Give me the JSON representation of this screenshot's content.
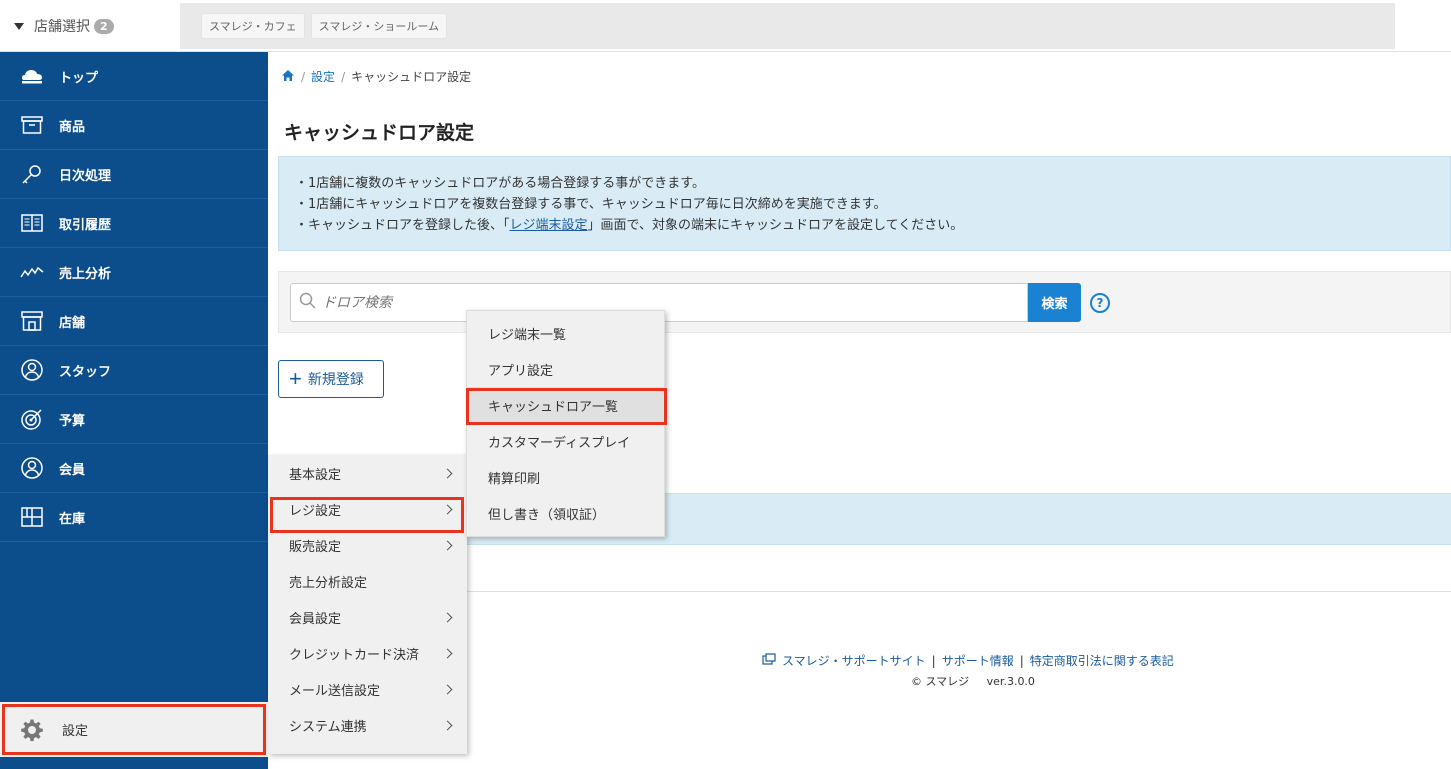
{
  "topbar": {
    "store_select_label": "店舗選択",
    "store_count": "2",
    "store_tabs": [
      "スマレジ・カフェ",
      "スマレジ・ショールーム"
    ]
  },
  "sidebar": {
    "items": [
      {
        "label": "トップ",
        "icon": "cloud-icon"
      },
      {
        "label": "商品",
        "icon": "box-icon"
      },
      {
        "label": "日次処理",
        "icon": "key-icon"
      },
      {
        "label": "取引履歴",
        "icon": "book-icon"
      },
      {
        "label": "売上分析",
        "icon": "chart-line-icon"
      },
      {
        "label": "店舗",
        "icon": "store-icon"
      },
      {
        "label": "スタッフ",
        "icon": "person-icon"
      },
      {
        "label": "予算",
        "icon": "target-icon"
      },
      {
        "label": "会員",
        "icon": "member-icon"
      },
      {
        "label": "在庫",
        "icon": "grid-icon"
      }
    ],
    "settings_label": "設定"
  },
  "breadcrumb": {
    "level1": "設定",
    "current": "キャッシュドロア設定"
  },
  "page": {
    "title": "キャッシュドロア設定",
    "info_line1": "・1店舗に複数のキャッシュドロアがある場合登録する事ができます。",
    "info_line2": "・1店舗にキャッシュドロアを複数台登録する事で、キャッシュドロア毎に日次締めを実施できます。",
    "info_line3_prefix": "・キャッシュドロアを登録した後、「",
    "info_line3_link": "レジ端末設定",
    "info_line3_suffix": "」画面で、対象の端末にキャッシュドロアを設定してください。",
    "search_placeholder": "ドロア検索",
    "search_button": "検索",
    "help": "?",
    "new_button": "新規登録"
  },
  "menu_level1": {
    "items": [
      {
        "label": "基本設定",
        "has_sub": true
      },
      {
        "label": "レジ設定",
        "has_sub": true
      },
      {
        "label": "販売設定",
        "has_sub": true
      },
      {
        "label": "売上分析設定",
        "has_sub": false
      },
      {
        "label": "会員設定",
        "has_sub": true
      },
      {
        "label": "クレジットカード決済",
        "has_sub": true
      },
      {
        "label": "メール送信設定",
        "has_sub": true
      },
      {
        "label": "システム連携",
        "has_sub": true
      }
    ]
  },
  "menu_level2": {
    "items": [
      {
        "label": "レジ端末一覧"
      },
      {
        "label": "アプリ設定"
      },
      {
        "label": "キャッシュドロア一覧"
      },
      {
        "label": "カスタマーディスプレイ"
      },
      {
        "label": "精算印刷"
      },
      {
        "label": "但し書き（領収証）"
      }
    ]
  },
  "footer": {
    "support_site": "スマレジ・サポートサイト",
    "support_info": "サポート情報",
    "legal": "特定商取引法に関する表記",
    "copyright": "© スマレジ",
    "version": "ver.3.0.0"
  },
  "colors": {
    "sidebar_bg": "#0c4d8c",
    "accent": "#1a82d2",
    "highlight_border": "#e8341c",
    "info_bg": "#d9ecf6"
  }
}
